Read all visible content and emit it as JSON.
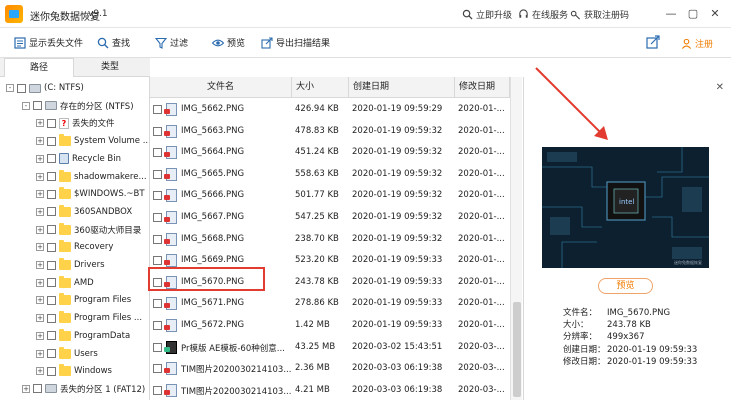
{
  "app": {
    "title": "迷你兔数据恢复",
    "version": "v9.1",
    "links": [
      "立即升级",
      "在线服务",
      "获取注册码"
    ],
    "window_controls": [
      "minimize-icon",
      "maximize-icon",
      "close-icon"
    ]
  },
  "toolbar": {
    "items": [
      "显示丢失文件",
      "查找",
      "过滤",
      "预览",
      "导出扫描结果"
    ],
    "register": "注册"
  },
  "tabs": {
    "path": "路径",
    "type": "类型"
  },
  "tree": [
    {
      "label": "(C: NTFS)",
      "level": 0,
      "icon": "drive-icon",
      "expander": "-"
    },
    {
      "label": "存在的分区 (NTFS)",
      "level": 1,
      "icon": "drive-icon",
      "expander": "-"
    },
    {
      "label": "丢失的文件",
      "level": 2,
      "icon": "lost-files-icon",
      "expander": "+"
    },
    {
      "label": "System Volume ...",
      "level": 2,
      "icon": "folder-icon",
      "expander": "+"
    },
    {
      "label": "Recycle Bin",
      "level": 2,
      "icon": "recycle-bin-icon",
      "expander": "+"
    },
    {
      "label": "shadowmakere...",
      "level": 2,
      "icon": "folder-icon",
      "expander": "+"
    },
    {
      "label": "$WINDOWS.~BT",
      "level": 2,
      "icon": "folder-icon",
      "expander": "+"
    },
    {
      "label": "360SANDBOX",
      "level": 2,
      "icon": "folder-icon",
      "expander": "+"
    },
    {
      "label": "360驱动大师目录",
      "level": 2,
      "icon": "folder-icon",
      "expander": "+"
    },
    {
      "label": "Recovery",
      "level": 2,
      "icon": "folder-icon",
      "expander": "+"
    },
    {
      "label": "Drivers",
      "level": 2,
      "icon": "folder-icon",
      "expander": "+"
    },
    {
      "label": "AMD",
      "level": 2,
      "icon": "folder-icon",
      "expander": "+"
    },
    {
      "label": "Program Files",
      "level": 2,
      "icon": "folder-icon",
      "expander": "+"
    },
    {
      "label": "Program Files ...",
      "level": 2,
      "icon": "folder-icon",
      "expander": "+"
    },
    {
      "label": "ProgramData",
      "level": 2,
      "icon": "folder-icon",
      "expander": "+"
    },
    {
      "label": "Users",
      "level": 2,
      "icon": "folder-icon",
      "expander": "+"
    },
    {
      "label": "Windows",
      "level": 2,
      "icon": "folder-icon",
      "expander": "+"
    },
    {
      "label": "丢失的分区 1 (FAT12)",
      "level": 1,
      "icon": "drive-icon",
      "expander": "+"
    }
  ],
  "file_columns": [
    "文件名",
    "大小",
    "创建日期",
    "修改日期"
  ],
  "files": [
    {
      "name": "IMG_5662.PNG",
      "size": "426.94 KB",
      "created": "2020-01-19 09:59:29",
      "modified": "2020-01-...",
      "icon": "image"
    },
    {
      "name": "IMG_5663.PNG",
      "size": "478.83 KB",
      "created": "2020-01-19 09:59:32",
      "modified": "2020-01-...",
      "icon": "image"
    },
    {
      "name": "IMG_5664.PNG",
      "size": "451.24 KB",
      "created": "2020-01-19 09:59:32",
      "modified": "2020-01-...",
      "icon": "image"
    },
    {
      "name": "IMG_5665.PNG",
      "size": "558.63 KB",
      "created": "2020-01-19 09:59:32",
      "modified": "2020-01-...",
      "icon": "image"
    },
    {
      "name": "IMG_5666.PNG",
      "size": "501.77 KB",
      "created": "2020-01-19 09:59:32",
      "modified": "2020-01-...",
      "icon": "image"
    },
    {
      "name": "IMG_5667.PNG",
      "size": "547.25 KB",
      "created": "2020-01-19 09:59:32",
      "modified": "2020-01-...",
      "icon": "image"
    },
    {
      "name": "IMG_5668.PNG",
      "size": "238.70 KB",
      "created": "2020-01-19 09:59:32",
      "modified": "2020-01-...",
      "icon": "image"
    },
    {
      "name": "IMG_5669.PNG",
      "size": "523.20 KB",
      "created": "2020-01-19 09:59:33",
      "modified": "2020-01-...",
      "icon": "image"
    },
    {
      "name": "IMG_5670.PNG",
      "size": "243.78 KB",
      "created": "2020-01-19 09:59:33",
      "modified": "2020-01-...",
      "icon": "image"
    },
    {
      "name": "IMG_5671.PNG",
      "size": "278.86 KB",
      "created": "2020-01-19 09:59:33",
      "modified": "2020-01-...",
      "icon": "image"
    },
    {
      "name": "IMG_5672.PNG",
      "size": "1.42 MB",
      "created": "2020-01-19 09:59:33",
      "modified": "2020-01-...",
      "icon": "image"
    },
    {
      "name": "Pr模版 AE模板-60种创意...",
      "size": "43.25 MB",
      "created": "2020-03-02 15:43:51",
      "modified": "2020-03-...",
      "icon": "video"
    },
    {
      "name": "TIM图片2020030214103...",
      "size": "2.36 MB",
      "created": "2020-03-03 06:19:38",
      "modified": "2020-03-...",
      "icon": "image"
    },
    {
      "name": "TIM图片2020030214103...",
      "size": "4.21 MB",
      "created": "2020-03-03 06:19:38",
      "modified": "2020-03-...",
      "icon": "image"
    }
  ],
  "preview": {
    "button": "预览",
    "image_caption": "迷你兔数据恢复",
    "details": [
      {
        "key": "文件名：",
        "value": "IMG_5670.PNG"
      },
      {
        "key": "大小：",
        "value": "243.78 KB"
      },
      {
        "key": "分辨率：",
        "value": "499x367"
      },
      {
        "key": "创建日期：",
        "value": "2020-01-19 09:59:33"
      },
      {
        "key": "修改日期：",
        "value": "2020-01-19 09:59:33"
      }
    ]
  },
  "colors": {
    "accent": "#f07c00",
    "highlight": "#e23b2f",
    "chip": "#0d2130"
  }
}
